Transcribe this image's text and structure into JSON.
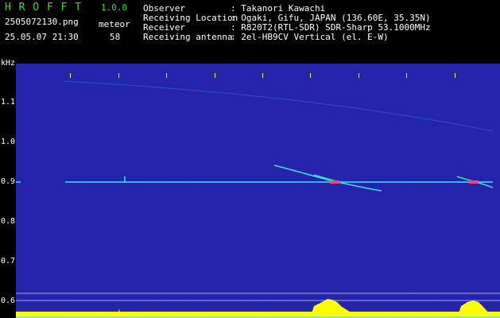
{
  "app": {
    "name": "H R O F F T",
    "version": "1.0.0"
  },
  "file": {
    "name": "2505072130.png",
    "datetime": "25.05.07 21:30",
    "type_label": "meteor",
    "count": "58"
  },
  "info": {
    "rows": [
      {
        "label": "Observer",
        "value": ": Takanori Kawachi"
      },
      {
        "label": "Receiving Location",
        "value": ": Ogaki, Gifu, JAPAN (136.60E, 35.35N)"
      },
      {
        "label": "Receiver",
        "value": ": R820T2(RTL-SDR) SDR-Sharp 53.1000MHz"
      },
      {
        "label": "Receiving antenna",
        "value": ": 2el-HB9CV Vertical (el. E-W)"
      }
    ]
  },
  "axis": {
    "y_unit": "kHz",
    "y_ticks": [
      "1.1",
      "1.0",
      "0.9",
      "0.8",
      "0.7",
      "0.6"
    ],
    "x_ticks": [
      "2131",
      "2132",
      "2133",
      "2134",
      "2135",
      "2136",
      "2137",
      "2138",
      "2139",
      "2140"
    ]
  },
  "colors": {
    "background": "#000000",
    "waterfall_noise": "#10107a",
    "carrier": "#40e0ff",
    "meteor_hot": "#ff4080",
    "histogram": "#ffff00",
    "title": "#3cdc3c",
    "text": "#ffffff",
    "axis": "#ffff00"
  }
}
